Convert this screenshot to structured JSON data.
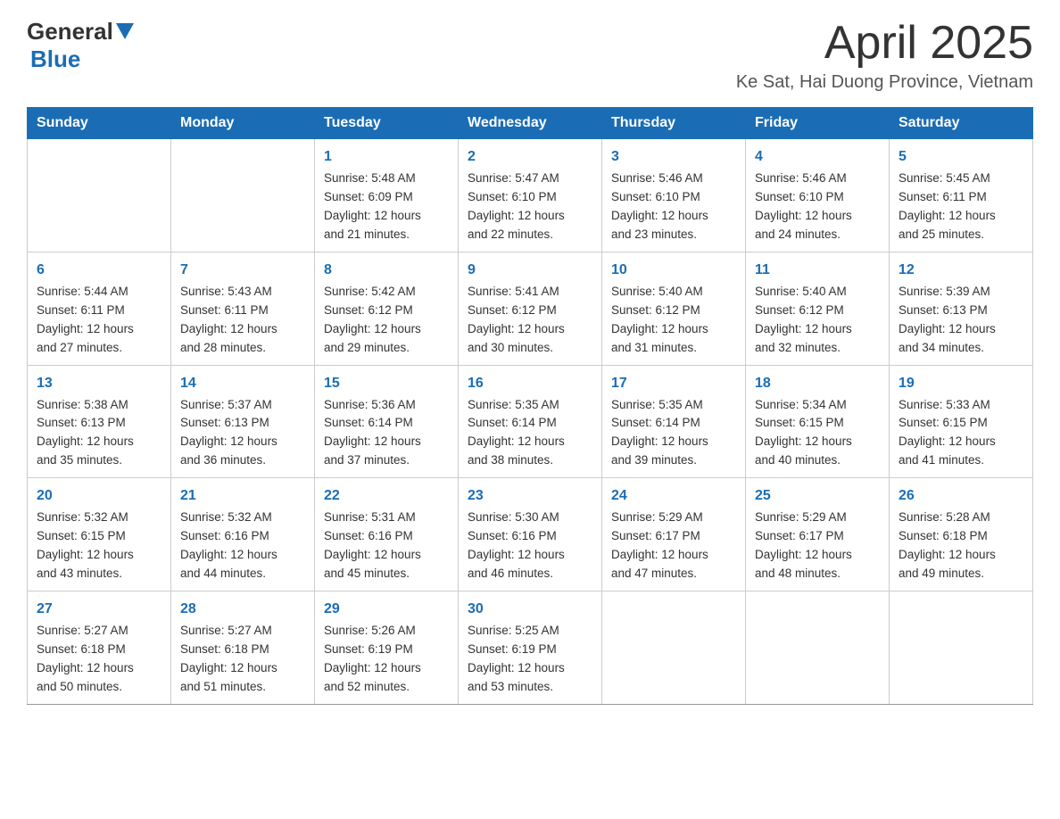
{
  "header": {
    "logo_general": "General",
    "logo_blue": "Blue",
    "month_title": "April 2025",
    "location": "Ke Sat, Hai Duong Province, Vietnam"
  },
  "days_of_week": [
    "Sunday",
    "Monday",
    "Tuesday",
    "Wednesday",
    "Thursday",
    "Friday",
    "Saturday"
  ],
  "weeks": [
    [
      null,
      null,
      {
        "day": "1",
        "sunrise": "5:48 AM",
        "sunset": "6:09 PM",
        "daylight": "12 hours and 21 minutes."
      },
      {
        "day": "2",
        "sunrise": "5:47 AM",
        "sunset": "6:10 PM",
        "daylight": "12 hours and 22 minutes."
      },
      {
        "day": "3",
        "sunrise": "5:46 AM",
        "sunset": "6:10 PM",
        "daylight": "12 hours and 23 minutes."
      },
      {
        "day": "4",
        "sunrise": "5:46 AM",
        "sunset": "6:10 PM",
        "daylight": "12 hours and 24 minutes."
      },
      {
        "day": "5",
        "sunrise": "5:45 AM",
        "sunset": "6:11 PM",
        "daylight": "12 hours and 25 minutes."
      }
    ],
    [
      {
        "day": "6",
        "sunrise": "5:44 AM",
        "sunset": "6:11 PM",
        "daylight": "12 hours and 27 minutes."
      },
      {
        "day": "7",
        "sunrise": "5:43 AM",
        "sunset": "6:11 PM",
        "daylight": "12 hours and 28 minutes."
      },
      {
        "day": "8",
        "sunrise": "5:42 AM",
        "sunset": "6:12 PM",
        "daylight": "12 hours and 29 minutes."
      },
      {
        "day": "9",
        "sunrise": "5:41 AM",
        "sunset": "6:12 PM",
        "daylight": "12 hours and 30 minutes."
      },
      {
        "day": "10",
        "sunrise": "5:40 AM",
        "sunset": "6:12 PM",
        "daylight": "12 hours and 31 minutes."
      },
      {
        "day": "11",
        "sunrise": "5:40 AM",
        "sunset": "6:12 PM",
        "daylight": "12 hours and 32 minutes."
      },
      {
        "day": "12",
        "sunrise": "5:39 AM",
        "sunset": "6:13 PM",
        "daylight": "12 hours and 34 minutes."
      }
    ],
    [
      {
        "day": "13",
        "sunrise": "5:38 AM",
        "sunset": "6:13 PM",
        "daylight": "12 hours and 35 minutes."
      },
      {
        "day": "14",
        "sunrise": "5:37 AM",
        "sunset": "6:13 PM",
        "daylight": "12 hours and 36 minutes."
      },
      {
        "day": "15",
        "sunrise": "5:36 AM",
        "sunset": "6:14 PM",
        "daylight": "12 hours and 37 minutes."
      },
      {
        "day": "16",
        "sunrise": "5:35 AM",
        "sunset": "6:14 PM",
        "daylight": "12 hours and 38 minutes."
      },
      {
        "day": "17",
        "sunrise": "5:35 AM",
        "sunset": "6:14 PM",
        "daylight": "12 hours and 39 minutes."
      },
      {
        "day": "18",
        "sunrise": "5:34 AM",
        "sunset": "6:15 PM",
        "daylight": "12 hours and 40 minutes."
      },
      {
        "day": "19",
        "sunrise": "5:33 AM",
        "sunset": "6:15 PM",
        "daylight": "12 hours and 41 minutes."
      }
    ],
    [
      {
        "day": "20",
        "sunrise": "5:32 AM",
        "sunset": "6:15 PM",
        "daylight": "12 hours and 43 minutes."
      },
      {
        "day": "21",
        "sunrise": "5:32 AM",
        "sunset": "6:16 PM",
        "daylight": "12 hours and 44 minutes."
      },
      {
        "day": "22",
        "sunrise": "5:31 AM",
        "sunset": "6:16 PM",
        "daylight": "12 hours and 45 minutes."
      },
      {
        "day": "23",
        "sunrise": "5:30 AM",
        "sunset": "6:16 PM",
        "daylight": "12 hours and 46 minutes."
      },
      {
        "day": "24",
        "sunrise": "5:29 AM",
        "sunset": "6:17 PM",
        "daylight": "12 hours and 47 minutes."
      },
      {
        "day": "25",
        "sunrise": "5:29 AM",
        "sunset": "6:17 PM",
        "daylight": "12 hours and 48 minutes."
      },
      {
        "day": "26",
        "sunrise": "5:28 AM",
        "sunset": "6:18 PM",
        "daylight": "12 hours and 49 minutes."
      }
    ],
    [
      {
        "day": "27",
        "sunrise": "5:27 AM",
        "sunset": "6:18 PM",
        "daylight": "12 hours and 50 minutes."
      },
      {
        "day": "28",
        "sunrise": "5:27 AM",
        "sunset": "6:18 PM",
        "daylight": "12 hours and 51 minutes."
      },
      {
        "day": "29",
        "sunrise": "5:26 AM",
        "sunset": "6:19 PM",
        "daylight": "12 hours and 52 minutes."
      },
      {
        "day": "30",
        "sunrise": "5:25 AM",
        "sunset": "6:19 PM",
        "daylight": "12 hours and 53 minutes."
      },
      null,
      null,
      null
    ]
  ],
  "labels": {
    "sunrise_prefix": "Sunrise: ",
    "sunset_prefix": "Sunset: ",
    "daylight_prefix": "Daylight: "
  }
}
